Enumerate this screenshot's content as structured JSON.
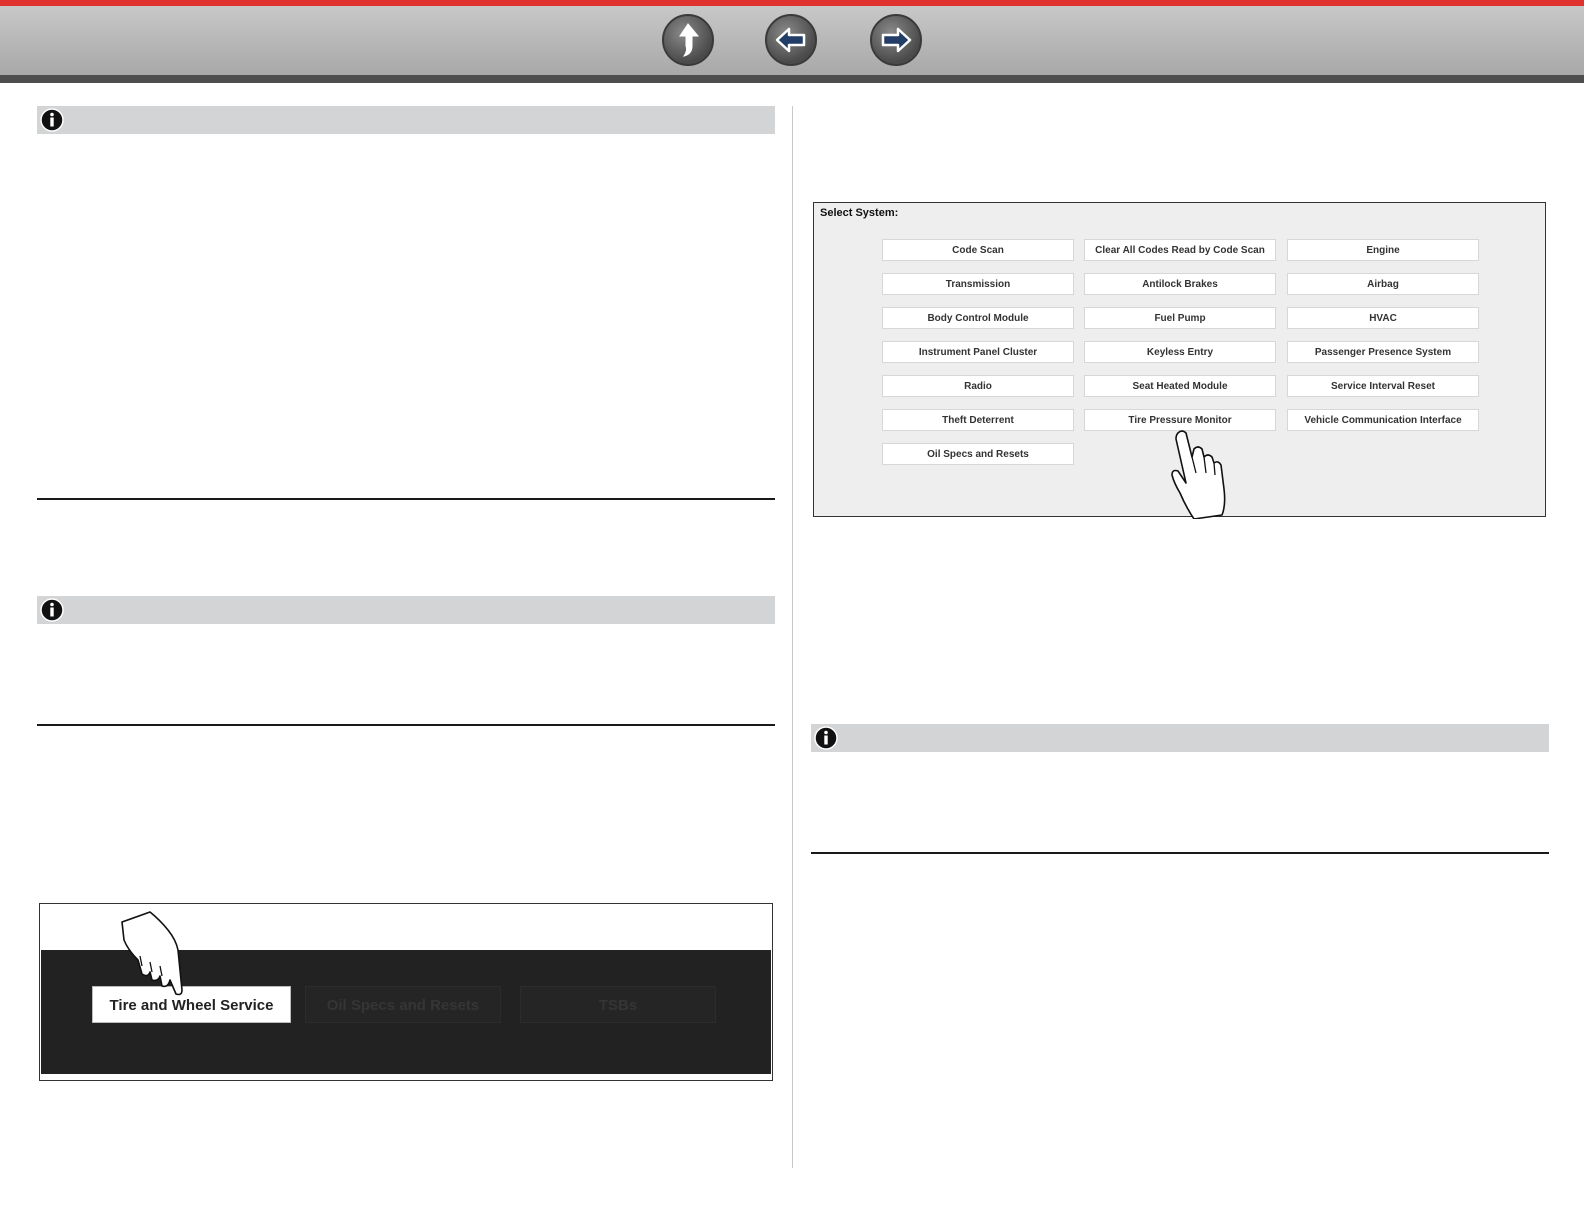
{
  "navigation": {
    "up_icon": "up-arrow-icon",
    "back_icon": "left-arrow-icon",
    "forward_icon": "right-arrow-icon",
    "accent_color": "#e0312f"
  },
  "notes": {
    "icon": "info-icon"
  },
  "select_system": {
    "title": "Select System:",
    "buttons": [
      "Code Scan",
      "Clear All Codes Read by Code Scan",
      "Engine",
      "Transmission",
      "Antilock Brakes",
      "Airbag",
      "Body Control Module",
      "Fuel Pump",
      "HVAC",
      "Instrument Panel Cluster",
      "Keyless Entry",
      "Passenger Presence System",
      "Radio",
      "Seat Heated Module",
      "Service Interval Reset",
      "Theft Deterrent",
      "Tire Pressure Monitor",
      "Vehicle Communication Interface",
      "Oil Specs and Resets"
    ],
    "pointer_icon": "pointing-hand-icon"
  },
  "service_menu": {
    "buttons": [
      "Tire and Wheel Service",
      "Oil Specs and Resets",
      "TSBs"
    ],
    "selected": "Tire and Wheel Service",
    "pointer_icon": "pointing-hand-icon"
  }
}
